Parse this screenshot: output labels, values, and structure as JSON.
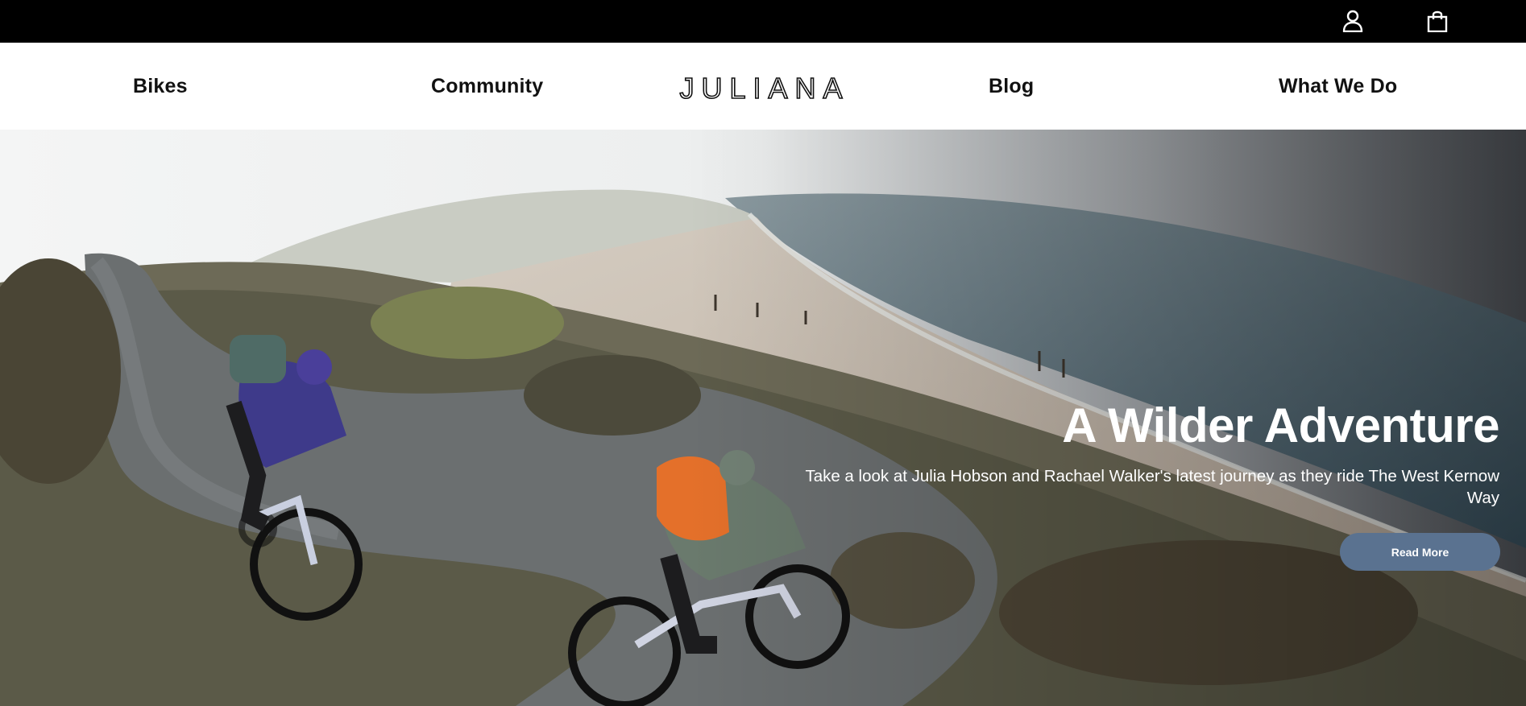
{
  "topbar": {
    "account_icon": "user-icon",
    "cart_icon": "shopping-bag-icon"
  },
  "nav": {
    "items": [
      {
        "label": "Bikes"
      },
      {
        "label": "Community"
      },
      {
        "label": "Blog"
      },
      {
        "label": "What We Do"
      }
    ],
    "logo": "JULIANA"
  },
  "hero": {
    "title": "A Wilder Adventure",
    "description": "Take a look at Julia Hobson and Rachael Walker's latest journey as they ride The West Kernow Way",
    "button_label": "Read More",
    "button_color": "#5a7290"
  }
}
